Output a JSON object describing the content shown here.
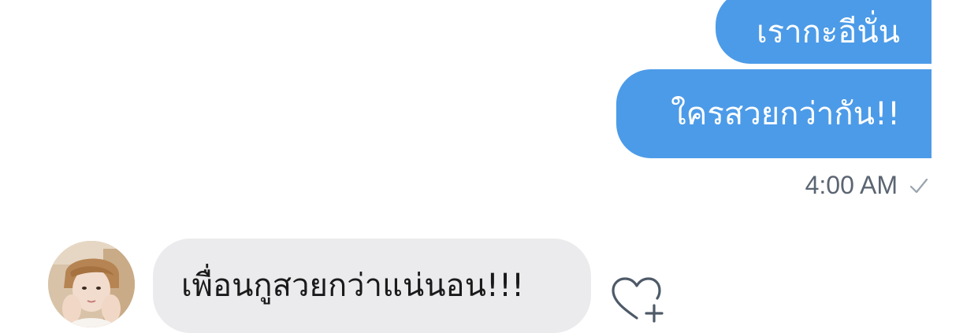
{
  "messages": [
    {
      "direction": "outgoing",
      "text": "เรากะอีนั่น"
    },
    {
      "direction": "outgoing",
      "text": "ใครสวยกว่ากัน!!"
    },
    {
      "direction": "incoming",
      "text": "เพื่อนกูสวยกว่าแน่นอน!!!"
    }
  ],
  "outgoing_meta": {
    "time": "4:00 AM",
    "status_icon": "check-icon"
  },
  "incoming_meta": {
    "avatar": "contact-avatar",
    "reaction_icon": "heart-add-icon"
  },
  "colors": {
    "outgoing_bubble": "#4c9be8",
    "incoming_bubble": "#ebebed",
    "outgoing_text": "#ffffff",
    "incoming_text": "#1a1a1a",
    "meta_text": "#5b6572"
  }
}
